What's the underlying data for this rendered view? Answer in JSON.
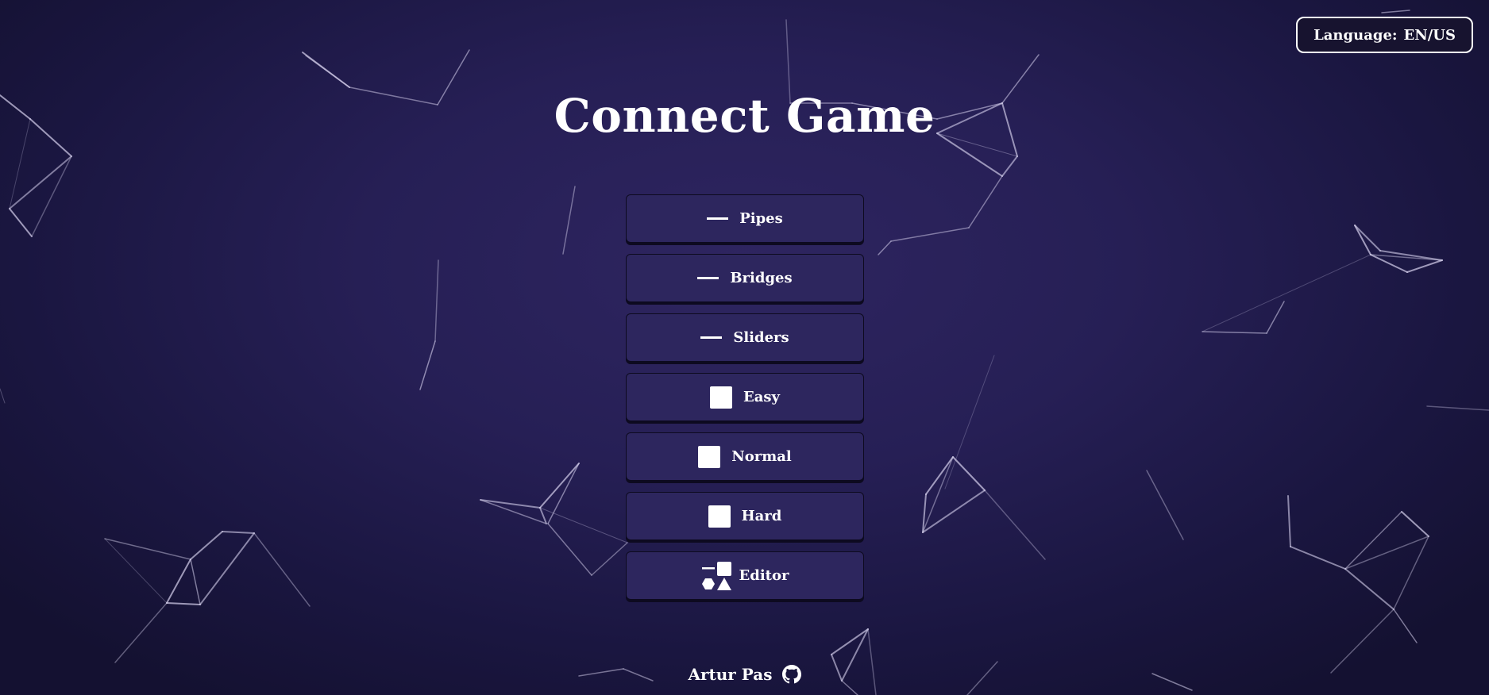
{
  "language": {
    "label": "Language:",
    "value": "EN/US"
  },
  "title": "Connect Game",
  "menu": [
    {
      "label": "Pipes",
      "icon": "dash-icon"
    },
    {
      "label": "Bridges",
      "icon": "dash-icon"
    },
    {
      "label": "Sliders",
      "icon": "dash-icon"
    },
    {
      "label": "Easy",
      "icon": "square-icon"
    },
    {
      "label": "Normal",
      "icon": "square-icon"
    },
    {
      "label": "Hard",
      "icon": "square-icon"
    },
    {
      "label": "Editor",
      "icon": "shapes-icon"
    }
  ],
  "footer": {
    "author": "Artur Pas",
    "icon": "github-icon"
  },
  "colors": {
    "background": "#261f55",
    "button": "#2d265e",
    "text": "#ffffff",
    "network_lines": "#d7d2ee"
  }
}
